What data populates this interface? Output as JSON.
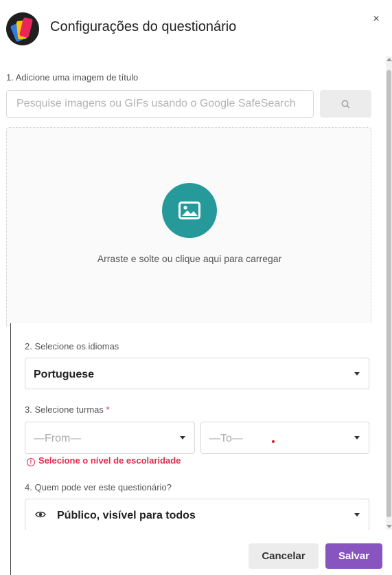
{
  "header": {
    "title": "Configurações do questionário",
    "close_label": "×",
    "logo_icon": "quizizz-logo-icon"
  },
  "section1": {
    "label": "1. Adicione uma imagem de título",
    "search_placeholder": "Pesquise imagens ou GIFs usando o Google SafeSearch",
    "search_button_icon": "search-icon",
    "dropzone_text": "Arraste e solte ou clique aqui para carregar",
    "upload_icon": "image-icon",
    "upload_color": "#26999a"
  },
  "section2": {
    "label": "2. Selecione os idiomas",
    "selected": "Portuguese"
  },
  "section3": {
    "label": "3. Selecione turmas",
    "required_mark": "*",
    "from_placeholder": "—From—",
    "to_placeholder": "—To—",
    "error": "Selecione o nível de escolaridade",
    "error_icon": "!",
    "error_color": "#e02e4c"
  },
  "section4": {
    "label": "4. Quem pode ver este questionário?",
    "selected": "Público, visível para todos",
    "icon": "eye-icon"
  },
  "footer": {
    "cancel_label": "Cancelar",
    "save_label": "Salvar",
    "save_color": "#8854c0"
  }
}
